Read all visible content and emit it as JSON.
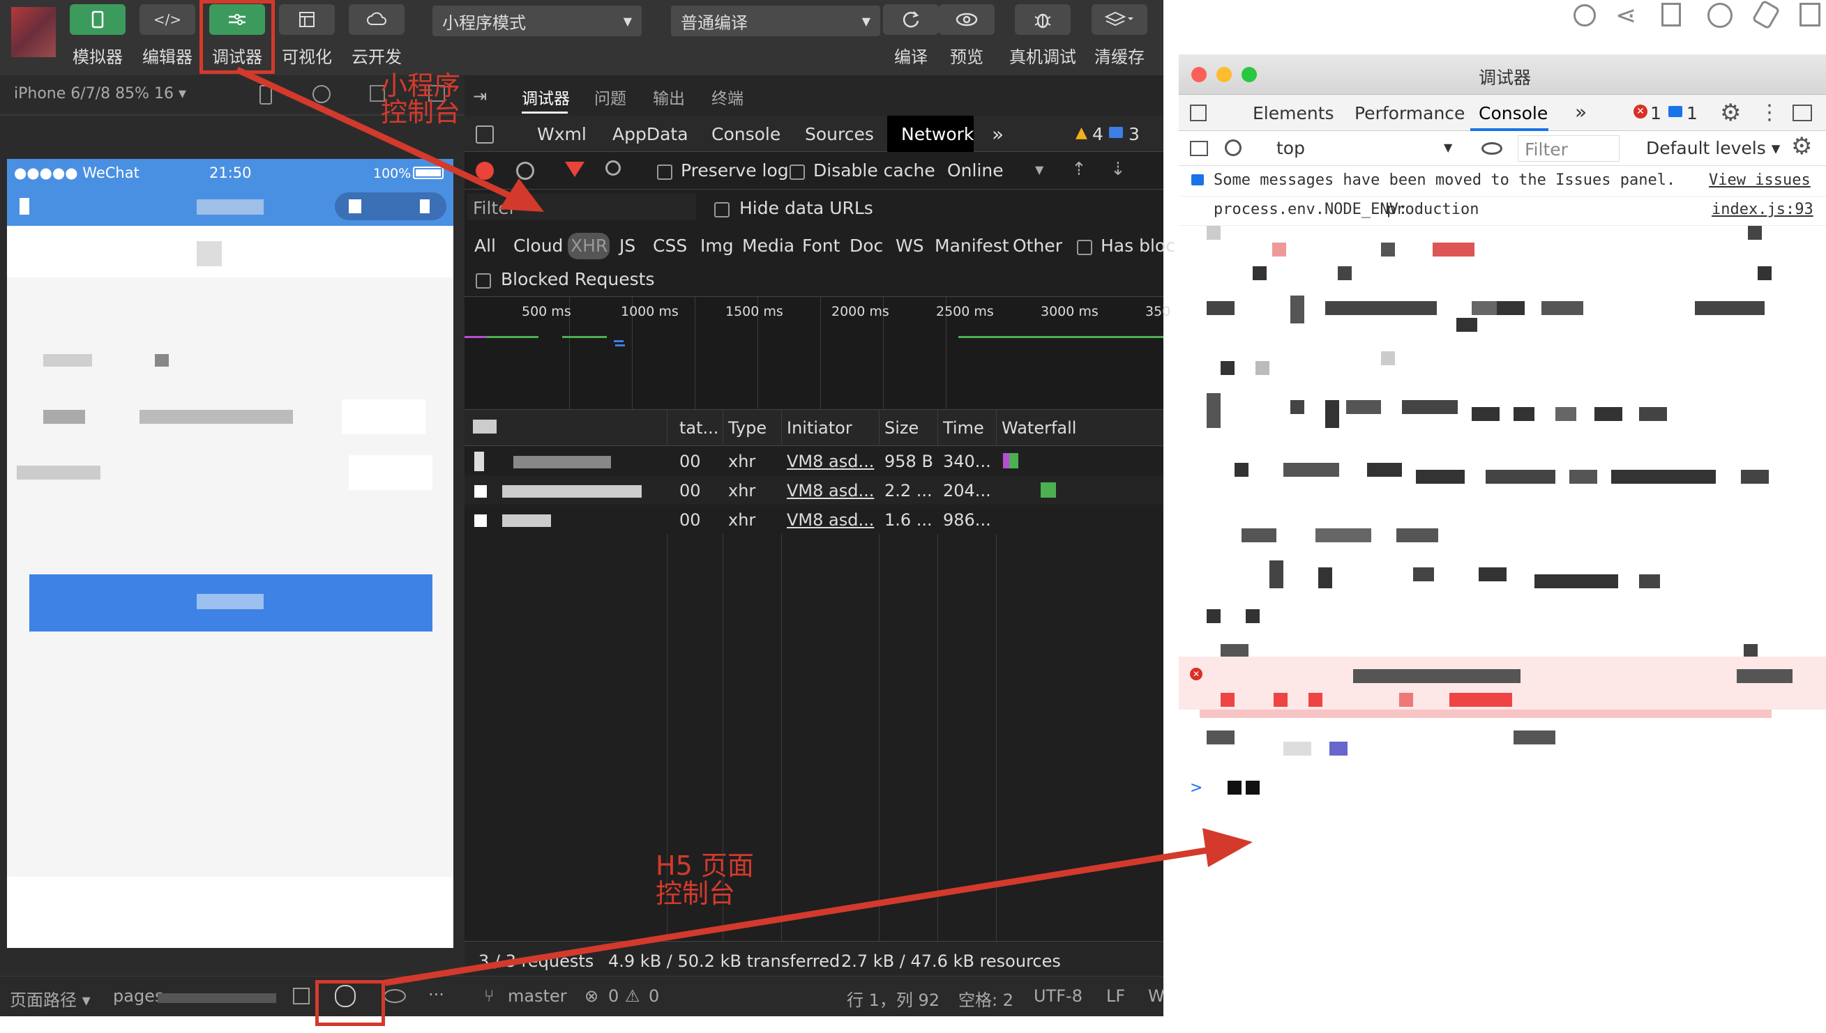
{
  "toolbar": {
    "buttons": [
      {
        "label": "模拟器",
        "icon": "phone-icon"
      },
      {
        "label": "编辑器",
        "icon": "code-icon"
      },
      {
        "label": "调试器",
        "icon": "debug-icon"
      },
      {
        "label": "可视化",
        "icon": "layout-icon"
      },
      {
        "label": "云开发",
        "icon": "cloud-icon"
      }
    ],
    "mode_select": "小程序模式",
    "compile_select": "普通编译",
    "right_buttons": [
      "编译",
      "预览",
      "真机调试",
      "清缓存"
    ]
  },
  "simulator": {
    "device": "iPhone 6/7/8 85% 16 ▾",
    "status_carrier": "●●●●● WeChat",
    "status_time": "21:50",
    "status_battery": "100%"
  },
  "annotations": {
    "top_label_line1": "小程序",
    "top_label_line2": "控制台",
    "bottom_label_line1": "H5 页面",
    "bottom_label_line2": "控制台",
    "color": "#d33a2c"
  },
  "debugger": {
    "top_tabs": [
      "调试器",
      "问题",
      "输出",
      "终端"
    ],
    "tabs": [
      "Wxml",
      "AppData",
      "Console",
      "Sources",
      "Network"
    ],
    "active_tab": "Network",
    "warn_count": "4",
    "info_count": "3",
    "preserve_log": "Preserve log",
    "disable_cache": "Disable cache",
    "throttle": "Online",
    "filter_placeholder": "Filter",
    "hide_data_urls": "Hide data URLs",
    "types": [
      "All",
      "Cloud",
      "XHR",
      "JS",
      "CSS",
      "Img",
      "Media",
      "Font",
      "Doc",
      "WS",
      "Manifest",
      "Other"
    ],
    "has_blocked": "Has bloc",
    "blocked_requests": "Blocked Requests",
    "timeline_ticks": [
      "500 ms",
      "1000 ms",
      "1500 ms",
      "2000 ms",
      "2500 ms",
      "3000 ms",
      "350"
    ],
    "columns": [
      "tat...",
      "Type",
      "Initiator",
      "Size",
      "Time",
      "Waterfall"
    ],
    "rows": [
      {
        "status": "00",
        "type": "xhr",
        "initiator": "VM8 asd...",
        "size": "958 B",
        "time": "340..."
      },
      {
        "status": "00",
        "type": "xhr",
        "initiator": "VM8 asd...",
        "size": "2.2 ...",
        "time": "204..."
      },
      {
        "status": "00",
        "type": "xhr",
        "initiator": "VM8 asd...",
        "size": "1.6 ...",
        "time": "986..."
      }
    ],
    "summary_requests": "3 / 3 requests",
    "summary_transferred": "4.9 kB / 50.2 kB transferred",
    "summary_resources": "2.7 kB / 47.6 kB resources"
  },
  "statusbar": {
    "page_path_label": "页面路径 ▾",
    "page_path": "pages",
    "branch": "master",
    "errors": "0",
    "warnings": "0",
    "position": "行 1，列 92",
    "spaces": "空格: 2",
    "encoding": "UTF-8",
    "eol": "LF",
    "tail": "W"
  },
  "chrome_devtools": {
    "title": "调试器",
    "tabs": [
      "Elements",
      "Performance",
      "Console"
    ],
    "active_tab": "Console",
    "error_count": "1",
    "msg_count": "1",
    "context": "top",
    "filter_placeholder": "Filter",
    "levels": "Default levels ▾",
    "issues_msg": "Some messages have been moved to the Issues panel.",
    "issues_link": "View issues",
    "log_key": "process.env.NODE_ENV:",
    "log_value": "production",
    "log_source": "index.js:93",
    "prompt": ">"
  }
}
